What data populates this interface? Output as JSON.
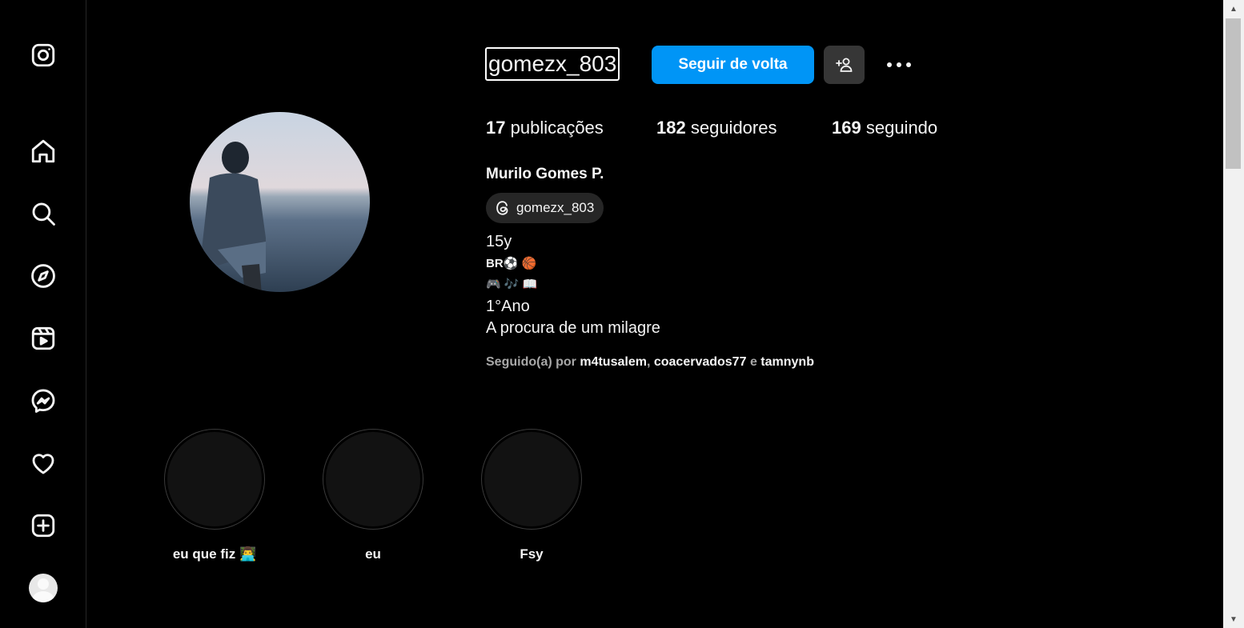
{
  "sidebar": {
    "icons": [
      "instagram-icon",
      "home-icon",
      "search-icon",
      "compass-icon",
      "reels-icon",
      "messenger-icon",
      "heart-icon",
      "create-icon",
      "profile-avatar"
    ]
  },
  "profile": {
    "username": "gomezx_803",
    "follow_button": "Seguir de volta",
    "stats": {
      "posts_count": "17",
      "posts_label": "publicações",
      "followers_count": "182",
      "followers_label": "seguidores",
      "following_count": "169",
      "following_label": "seguindo"
    },
    "full_name": "Murilo Gomes P.",
    "threads_handle": "gomezx_803",
    "bio": {
      "line1": "15y",
      "line2": "BR⚽ 🏀",
      "line3": "🎮 🎶 📖",
      "line4": "1°Ano",
      "line5": "A procura de um milagre"
    },
    "followed_by": {
      "prefix": "Seguido(a) por",
      "user1": "m4tusalem",
      "sep": ",",
      "user2": "coacervados77",
      "and": "e",
      "user3": "tamnynb"
    }
  },
  "highlights": [
    {
      "label": "eu que fiz 👨‍💻"
    },
    {
      "label": "eu"
    },
    {
      "label": "Fsy"
    }
  ],
  "colors": {
    "background": "#000000",
    "accent": "#0095f6",
    "secondary_button": "#363636",
    "chip": "#262626",
    "muted_text": "#a8a8a8"
  }
}
